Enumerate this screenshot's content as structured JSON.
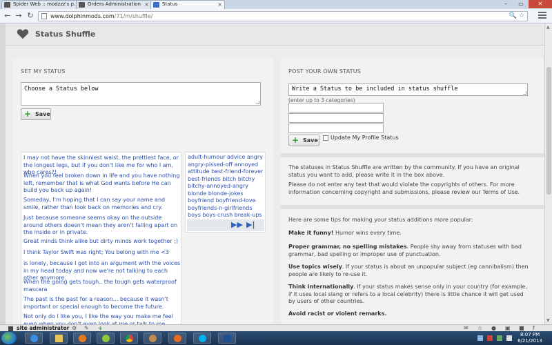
{
  "browser": {
    "tabs": [
      {
        "label": "Spider Web :: modzzz's p...",
        "active": false
      },
      {
        "label": "Orders Administration",
        "active": false
      },
      {
        "label": "Status",
        "active": true
      }
    ],
    "url_host": "www.dolphinmods.com",
    "url_path": "/71/m/shuffle/"
  },
  "header": {
    "title": "Status Shuffle"
  },
  "set_status": {
    "section_label": "SET MY STATUS",
    "status_value": "Choose a Status below",
    "save_label": "Save",
    "statuses": [
      "I may not have the skinniest waist, the prettiest face, or the longest legs, but if you don't like me for who I am, who cares?!",
      "When you feel broken down in life and you have nothing left, remember that is what God wants before He can build you back up again!",
      "Someday, I'm hoping that I can say your name and smile, rather than look back on memories and cry.",
      "Just because someone seems okay on the outside around others doesn't mean they aren't falling apart on the inside or in private.",
      "Great minds think alike but dirty minds work together ;)",
      "I think Taylor Swift was right; You belong with me <3",
      "is lonely, because I got into an argument with the voices in my head today and now we're not talking to each other anymore.",
      "When the going gets tough.. the tough gets waterproof mascara",
      "The past is the past for a reason... because it wasn't important or special enough to become the future.",
      "Not only do I like you, I like the way you make me feel even when you don't even look at me or talk to me."
    ],
    "categories": "adult-humour  advice  angry  angry-pissed-off  annoyed  attitude  best-friend-forever  best-friends  bitch  bitchy  bitchy-annoyed-angry  blonde  blonde-jokes  boyfriend  boyfriend-love  boyfriends-n-girlfriends  boys  boys-crush  break-ups  break-ups-broken-hearted"
  },
  "post_status": {
    "section_label": "POST YOUR OWN STATUS",
    "status_value": "Write a Status to be included in status shuffle",
    "categories_hint": "(enter up to 3 categories)",
    "save_label": "Save",
    "checkbox_label": "Update My Profile Status"
  },
  "info": {
    "p1": "The statuses in Status Shuffle are written by the community. If you have an original status you want to add, please write it in the box above.",
    "p2": "Please do not enter any text that would violate the copyrights of others. For more information concerning copyright and submissions, please review our Terms of Use."
  },
  "tips": {
    "intro": "Here are some tips for making your status additions more popular:",
    "items": [
      {
        "title": "Make it funny!",
        "text": " Humor wins every time."
      },
      {
        "title": "Proper grammar, no spelling mistakes",
        "text": ". People shy away from statuses with bad grammar, bad spelling or improper use of punctuation."
      },
      {
        "title": "Use topics wisely",
        "text": ". If your status is about an unpopular subject (eg cannibalism) then people are likely to re-use it."
      },
      {
        "title": "Think internationally",
        "text": ". If your status makes sense only in your country (for example, if it uses local slang or refers to a local celebrity) there is little chance it will get used by users of other countries."
      },
      {
        "title": "Avoid racist or violent remarks.",
        "text": ""
      }
    ]
  },
  "admin_bar": {
    "user": "site administrator"
  },
  "taskbar": {
    "time": "8:07 PM",
    "date": "6/21/2013"
  }
}
